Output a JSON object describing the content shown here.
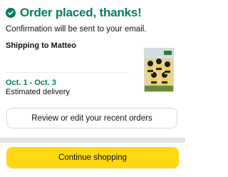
{
  "header": {
    "title": "Order placed, thanks!",
    "icon": "check-circle-icon"
  },
  "confirmation": {
    "text": "Confirmation will be sent to your email."
  },
  "shipping": {
    "label": "Shipping to Matteo"
  },
  "product": {
    "icon": "product-thumbnail"
  },
  "delivery": {
    "date": "Oct. 1 - Oct. 3",
    "label": "Estimated delivery"
  },
  "actions": {
    "review_label": "Review or edit your recent orders",
    "continue_label": "Continue shopping"
  },
  "colors": {
    "success_green": "#067d62",
    "button_yellow": "#ffd814",
    "border": "#d5d9d9"
  }
}
